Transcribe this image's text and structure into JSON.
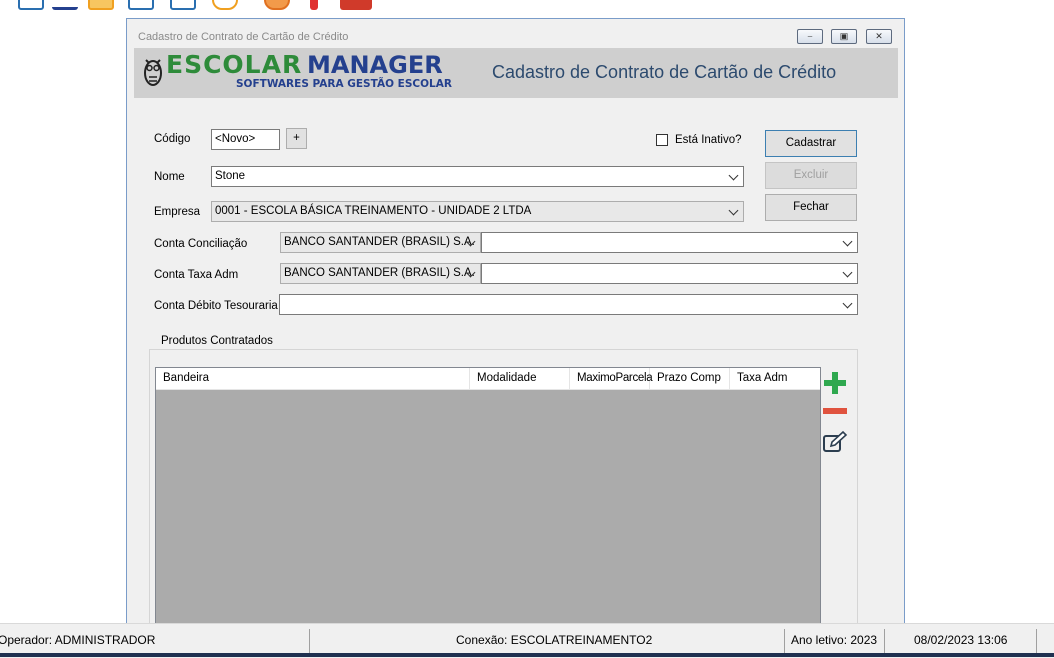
{
  "window": {
    "title": "Cadastro de Contrato de Cartão de Crédito",
    "controls": [
      "minimize",
      "maximize",
      "close"
    ]
  },
  "header": {
    "logo_left": "ESCOLAR",
    "logo_right": "MANAGER",
    "logo_sub": "SOFTWARES PARA GESTÃO ESCOLAR",
    "form_title": "Cadastro de Contrato de Cartão de Crédito"
  },
  "form": {
    "codigo_label": "Código",
    "codigo_value": "<Novo>",
    "codigo_plus": "+",
    "inativo_label": "Está Inativo?",
    "inativo_checked": false,
    "nome_label": "Nome",
    "nome_value": "Stone",
    "empresa_label": "Empresa",
    "empresa_value": "0001 - ESCOLA BÁSICA TREINAMENTO - UNIDADE 2 LTDA",
    "conta_conciliacao_label": "Conta Conciliação",
    "conta_conciliacao_bank": "BANCO SANTANDER (BRASIL) S.A.",
    "conta_conciliacao_account": "",
    "conta_taxa_label": "Conta Taxa Adm",
    "conta_taxa_bank": "BANCO SANTANDER (BRASIL) S.A.",
    "conta_taxa_account": "",
    "conta_debito_label": "Conta Débito Tesouraria",
    "conta_debito_value": ""
  },
  "buttons": {
    "cadastrar": "Cadastrar",
    "excluir": "Excluir",
    "fechar": "Fechar"
  },
  "produtos": {
    "group_title": "Produtos Contratados",
    "columns": [
      "Bandeira",
      "Modalidade",
      "MaximoParcela",
      "Prazo Comp",
      "Taxa Adm"
    ],
    "rows": []
  },
  "icons": {
    "add": "plus-icon",
    "remove": "minus-icon",
    "edit": "edit-icon",
    "add_color": "#2fa84f",
    "remove_color": "#e0533f"
  },
  "statusbar": {
    "operador": "Operador: ADMINISTRADOR",
    "conexao": "Conexão: ESCOLATREINAMENTO2",
    "ano": "Ano letivo: 2023",
    "datetime": "08/02/2023 13:06"
  }
}
